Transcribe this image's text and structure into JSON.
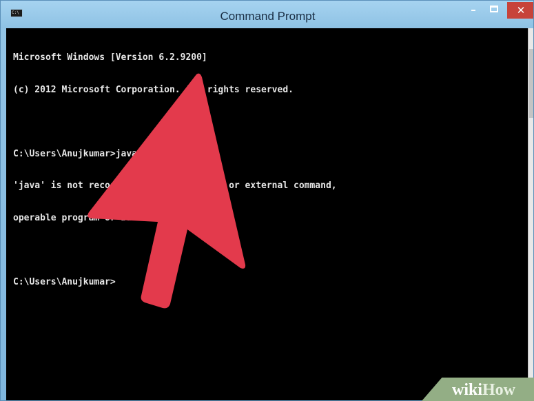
{
  "window": {
    "title": "Command Prompt",
    "icon": "cmd-icon",
    "icon_text": "C:\\",
    "controls": {
      "minimize": "–",
      "maximize": "maximize-icon",
      "close": "✕"
    }
  },
  "console": {
    "lines": [
      "Microsoft Windows [Version 6.2.9200]",
      "(c) 2012 Microsoft Corporation. All rights reserved.",
      "",
      "C:\\Users\\Anujkumar>java -version",
      "'java' is not recognized as an internal or external command,",
      "operable program or batch file.",
      "",
      "C:\\Users\\Anujkumar>"
    ]
  },
  "overlay": {
    "arrow_color": "#e33a4c",
    "arrow_icon": "pointer-arrow-icon"
  },
  "watermark": {
    "part1": "wiki",
    "part2": "How"
  },
  "colors": {
    "console_bg": "#000000",
    "console_text": "#e6e6e6",
    "titlebar": "#8ec2e4",
    "close_button": "#c7433a"
  }
}
